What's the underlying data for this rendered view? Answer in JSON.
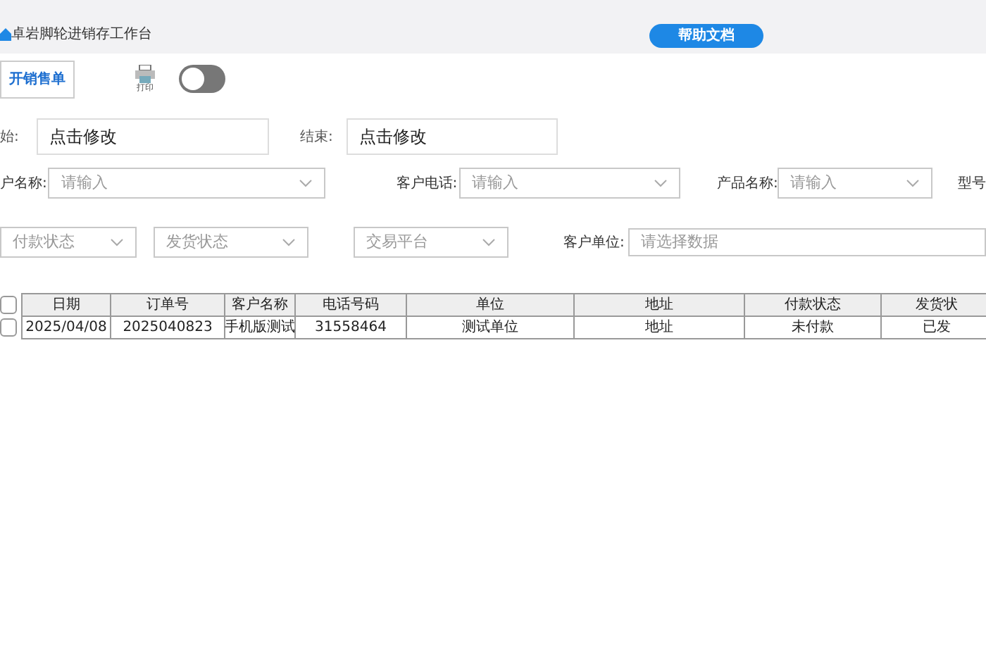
{
  "header": {
    "title": "卓岩脚轮进销存工作台",
    "help_button": "帮助文档"
  },
  "toolbar": {
    "new_order_button": "开销售单",
    "print_label": "打印",
    "toggle": {
      "on": false
    }
  },
  "date_row": [
    {
      "label": "始:",
      "value": "点击修改"
    },
    {
      "label": "结束:",
      "value": "点击修改"
    }
  ],
  "filter_row": [
    {
      "label": "户名称:",
      "placeholder": "请输入"
    },
    {
      "label": "客户电话:",
      "placeholder": "请输入"
    },
    {
      "label": "产品名称:",
      "placeholder": "请输入"
    }
  ],
  "filter_row_trailing_label": "型号",
  "status_selects": [
    {
      "placeholder": "付款状态"
    },
    {
      "placeholder": "发货状态"
    },
    {
      "placeholder": "交易平台"
    }
  ],
  "customer_unit": {
    "label": "客户单位:",
    "placeholder": "请选择数据"
  },
  "table": {
    "select_all": {
      "checked": false
    },
    "columns": [
      "日期",
      "订单号",
      "客户名称",
      "电话号码",
      "单位",
      "地址",
      "付款状态",
      "发货状"
    ],
    "rows": [
      {
        "checked": false,
        "cells": [
          "2025/04/08",
          "2025040823",
          "手机版测试",
          "31558464",
          "测试单位",
          "地址",
          "未付款",
          "已发"
        ]
      }
    ]
  }
}
